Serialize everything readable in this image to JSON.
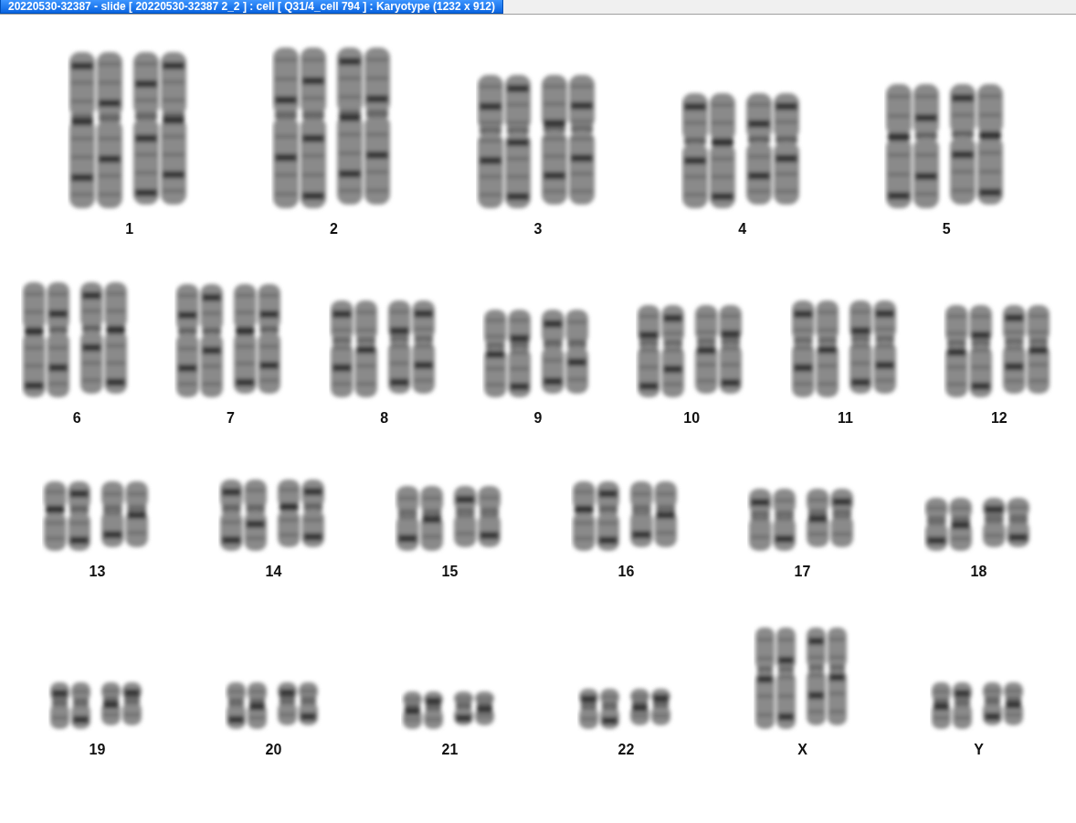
{
  "window": {
    "title": "20220530-32387 - slide [ 20220530-32387 2_2 ] : cell [ Q31/4_cell 794 ] : Karyotype  (1232 x 912)"
  },
  "karyotype": {
    "rows": [
      {
        "chromosomes": [
          {
            "label": "1"
          },
          {
            "label": "2"
          },
          {
            "label": "3"
          },
          {
            "label": "4"
          },
          {
            "label": "5"
          }
        ]
      },
      {
        "chromosomes": [
          {
            "label": "6"
          },
          {
            "label": "7"
          },
          {
            "label": "8"
          },
          {
            "label": "9"
          },
          {
            "label": "10"
          },
          {
            "label": "11"
          },
          {
            "label": "12"
          }
        ]
      },
      {
        "chromosomes": [
          {
            "label": "13"
          },
          {
            "label": "14"
          },
          {
            "label": "15"
          },
          {
            "label": "16"
          },
          {
            "label": "17"
          },
          {
            "label": "18"
          }
        ]
      },
      {
        "chromosomes": [
          {
            "label": "19"
          },
          {
            "label": "20"
          },
          {
            "label": "21"
          },
          {
            "label": "22"
          },
          {
            "label": "X"
          },
          {
            "label": "Y"
          }
        ]
      }
    ]
  }
}
